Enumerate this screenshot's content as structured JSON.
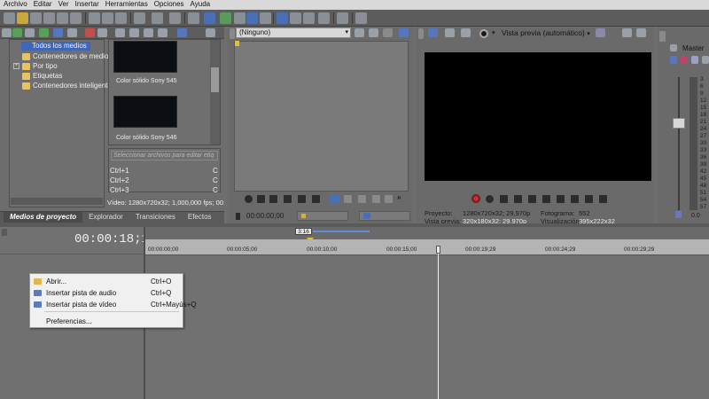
{
  "menubar": {
    "items": [
      "Archivo",
      "Editar",
      "Ver",
      "Insertar",
      "Herramientas",
      "Opciones",
      "Ayuda"
    ]
  },
  "media_tree": {
    "items": [
      {
        "label": "Todos los medios",
        "selected": true
      },
      {
        "label": "Contenedores de medios"
      },
      {
        "label": "Por tipo",
        "expandable": true
      },
      {
        "label": "Etiquetas"
      },
      {
        "label": "Contenedores inteligente"
      }
    ]
  },
  "media_thumbs": [
    {
      "label": "Color sólido Sony 545"
    },
    {
      "label": "Color sólido Sony 546"
    }
  ],
  "tag_editor": {
    "placeholder": "Seleccionar archivos para editar etiq",
    "rows": [
      {
        "key": "Ctrl+1",
        "val": "C"
      },
      {
        "key": "Ctrl+2",
        "val": "C"
      },
      {
        "key": "Ctrl+3",
        "val": "C"
      }
    ]
  },
  "media_info": "Vídeo: 1280x720x32; 1,000,000 fps; 00:",
  "tabs": [
    "Medios de proyecto",
    "Explorador",
    "Transiciones",
    "Efectos"
  ],
  "trimmer": {
    "dropdown": "(Ninguno)",
    "timecode": "00:00:00;00"
  },
  "preview": {
    "mode_label": "Vista previa (automático)",
    "proyecto_label": "Proyecto:",
    "proyecto_val": "1280x720x32; 29,970p",
    "vista_label": "Vista previa:",
    "vista_val": "320x180x32; 29,970p",
    "fotograma_label": "Fotograma:",
    "fotograma_val": "552",
    "visual_label": "Visualización:",
    "visual_val": "395x222x32"
  },
  "mixer": {
    "title": "Master",
    "scale": [
      "3",
      "6",
      "9",
      "12",
      "15",
      "18",
      "21",
      "24",
      "27",
      "30",
      "33",
      "36",
      "39",
      "42",
      "45",
      "48",
      "51",
      "54",
      "57"
    ],
    "bottom": "0.0"
  },
  "timeline": {
    "timecode": "00:00:18;12",
    "marker": "3:16",
    "ruler": [
      "00:00:00;00",
      "00:00:05;00",
      "00:00:10;00",
      "00:00:15;00",
      "00:00:19;29",
      "00:00:24;29",
      "00:00:29;29"
    ]
  },
  "context_menu": {
    "items": [
      {
        "label": "Abrir...",
        "shortcut": "Ctrl+O"
      },
      {
        "label": "Insertar pista de audio",
        "shortcut": "Ctrl+Q"
      },
      {
        "label": "Insertar pista de vídeo",
        "shortcut": "Ctrl+Mayús+Q"
      },
      {
        "label": "Preferencias...",
        "shortcut": ""
      }
    ]
  }
}
